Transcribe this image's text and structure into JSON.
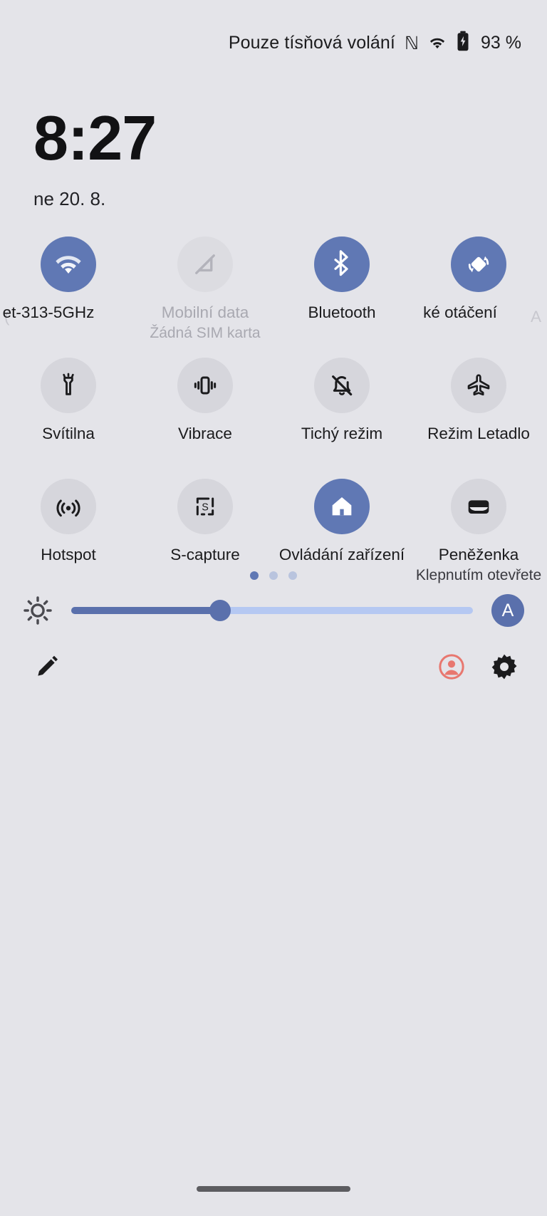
{
  "statusbar": {
    "carrier_text": "Pouze tísňová volání",
    "nfc_glyph": "ℕ",
    "battery_text": "93 %"
  },
  "lockclock": {
    "time": "8:27",
    "date": "ne 20. 8."
  },
  "tiles": {
    "row1": [
      {
        "label": "et-313-5GHz",
        "sub": "",
        "state": "on",
        "icon": "wifi-icon"
      },
      {
        "label": "Mobilní data",
        "sub": "Žádná SIM karta",
        "state": "disabled",
        "icon": "mobile-data-off-icon"
      },
      {
        "label": "Bluetooth",
        "sub": "",
        "state": "on",
        "icon": "bluetooth-icon"
      },
      {
        "label": "ké otáčení",
        "sub": "",
        "state": "on",
        "icon": "auto-rotate-icon"
      }
    ],
    "row2": [
      {
        "label": "Svítilna",
        "sub": "",
        "state": "off",
        "icon": "flashlight-icon"
      },
      {
        "label": "Vibrace",
        "sub": "",
        "state": "off",
        "icon": "vibrate-icon"
      },
      {
        "label": "Tichý režim",
        "sub": "",
        "state": "off",
        "icon": "bell-off-icon"
      },
      {
        "label": "Režim Letadlo",
        "sub": "",
        "state": "off",
        "icon": "airplane-icon"
      }
    ],
    "row3": [
      {
        "label": "Hotspot",
        "sub": "",
        "state": "off",
        "icon": "hotspot-icon"
      },
      {
        "label": "S-capture",
        "sub": "",
        "state": "off",
        "icon": "s-capture-icon"
      },
      {
        "label": "Ovládání zařízení",
        "sub": "",
        "state": "on",
        "icon": "home-icon"
      },
      {
        "label": "Peněženka",
        "sub": "Klepnutím otevřete",
        "state": "off",
        "icon": "wallet-icon"
      }
    ],
    "edge_ghost_left": "(",
    "edge_ghost_right": "A"
  },
  "pager": {
    "count": 3,
    "active_index": 0
  },
  "brightness": {
    "value_percent": 37,
    "auto_label": "A"
  },
  "colors": {
    "accent": "#6078b4",
    "slider_track": "#b5c8f2",
    "slider_fill": "#5a70ac",
    "tile_off": "#d6d6dc",
    "background": "#e4e4e9",
    "user_icon": "#e8776f"
  }
}
